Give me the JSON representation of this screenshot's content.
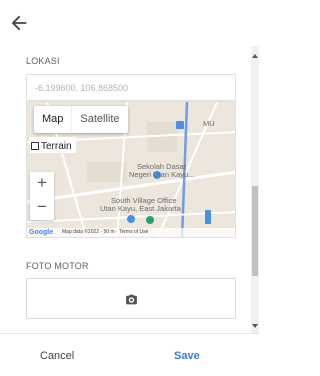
{
  "header": {
    "back_icon": "arrow-left-icon"
  },
  "location": {
    "label": "LOKASI",
    "coordinates": "-6.199600, 106.868500"
  },
  "map": {
    "map_type_map": "Map",
    "map_type_satellite": "Satellite",
    "terrain_label": "Terrain",
    "zoom_in": "+",
    "zoom_out": "−",
    "place_labels": {
      "mu": "MU",
      "school_1": "Sekolah Dasar",
      "school_2": "Negeri Utan Kayu...",
      "office_1": "South Village Office",
      "office_2": "Utan Kayu, East Jakarta"
    },
    "attribution": "Map data ©2022 · 50 m ·   Terms of Use",
    "logo": "Google",
    "colors": {
      "road": "#ffffff",
      "accent_road": "#6d9ce8",
      "poi": "#4a90e2",
      "poi_green": "#2e9e6b"
    }
  },
  "photo": {
    "label": "FOTO MOTOR",
    "camera_icon": "camera-icon"
  },
  "footer": {
    "cancel": "Cancel",
    "save": "Save"
  }
}
